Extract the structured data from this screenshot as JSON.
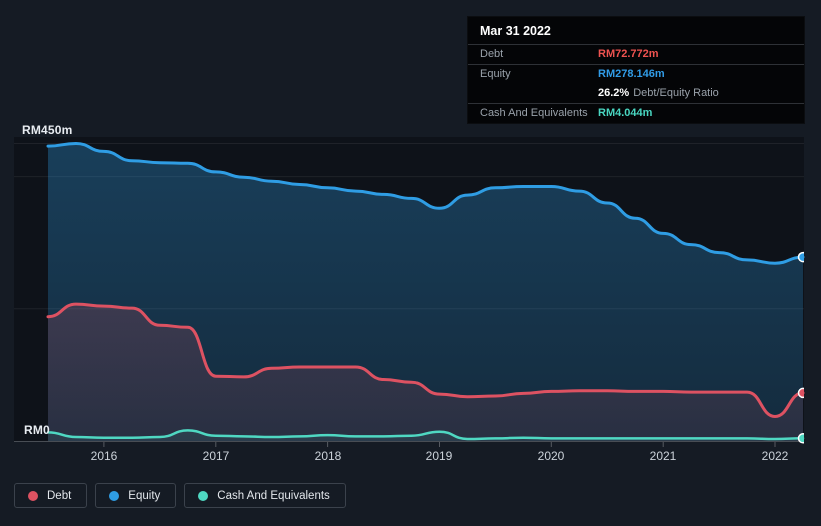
{
  "colors": {
    "background": "#151b24",
    "plot_background": "#0e1219",
    "debt": "#ef5350",
    "equity": "#319ce7",
    "cash": "#49d6c1"
  },
  "tooltip": {
    "date": "Mar 31 2022",
    "debt_label": "Debt",
    "debt_value": "RM72.772m",
    "equity_label": "Equity",
    "equity_value": "RM278.146m",
    "ratio_value": "26.2%",
    "ratio_label": "Debt/Equity Ratio",
    "cash_label": "Cash And Equivalents",
    "cash_value": "RM4.044m"
  },
  "legend": {
    "items": [
      {
        "label": "Debt"
      },
      {
        "label": "Equity"
      },
      {
        "label": "Cash And Equivalents"
      }
    ]
  },
  "chart_data": {
    "type": "area",
    "x_unit": "decimal_year_quarterly",
    "x": [
      2015.5,
      2015.75,
      2016,
      2016.25,
      2016.5,
      2016.75,
      2017,
      2017.25,
      2017.5,
      2017.75,
      2018,
      2018.25,
      2018.5,
      2018.75,
      2019,
      2019.25,
      2019.5,
      2019.75,
      2020,
      2020.25,
      2020.5,
      2020.75,
      2021,
      2021.25,
      2021.5,
      2021.75,
      2022,
      2022.25
    ],
    "series": [
      {
        "name": "Debt",
        "color": "#dd5262",
        "values": [
          188,
          207,
          204,
          201,
          175,
          172,
          98,
          97,
          110,
          112,
          112,
          112,
          93,
          89,
          71,
          67,
          68,
          72,
          75,
          76,
          76,
          75,
          75,
          74,
          74,
          74,
          37,
          72.772
        ]
      },
      {
        "name": "Equity",
        "color": "#2f9de4",
        "values": [
          446,
          450,
          438,
          424,
          421,
          420,
          407,
          399,
          393,
          388,
          383,
          378,
          373,
          367,
          352,
          372,
          383,
          385,
          385,
          378,
          360,
          337,
          314,
          297,
          285,
          274,
          269,
          278.146
        ]
      },
      {
        "name": "Cash And Equivalents",
        "color": "#4fd8c2",
        "values": [
          13,
          6,
          5,
          5,
          6,
          16,
          8,
          7,
          6,
          7,
          9,
          7,
          7,
          8,
          14,
          3,
          4,
          5,
          4,
          4,
          4,
          4,
          4,
          4,
          4,
          4,
          3,
          4.044
        ]
      }
    ],
    "ylim": [
      0,
      450
    ],
    "y_axis": {
      "top_label": "RM450m",
      "bottom_label": "RM0"
    },
    "grid_values": [
      450,
      400,
      200
    ],
    "x_ticks": [
      2016,
      2017,
      2018,
      2019,
      2020,
      2021,
      2022
    ],
    "x_tick_labels": [
      "2016",
      "2017",
      "2018",
      "2019",
      "2020",
      "2021",
      "2022"
    ],
    "last_point_date": "Mar 31 2022",
    "legend_position": "bottom-left",
    "grid": "horizontal-only"
  }
}
